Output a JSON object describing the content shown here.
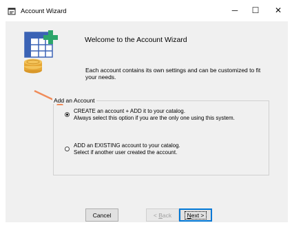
{
  "window": {
    "title": "Account Wizard",
    "controls": {
      "minimize": "─",
      "maximize": "☐",
      "close": "✕"
    }
  },
  "header": {
    "welcome_title": "Welcome to the Account Wizard",
    "intro_text": "Each account contains its own settings and can be customized to fit your needs.",
    "logo_icon": "spreadsheet-with-coins-icon"
  },
  "group": {
    "label": "Add an Account",
    "options": [
      {
        "line1": "CREATE an account + ADD it to your catalog.",
        "line2": "Always select this option if you are the only one using this system.",
        "selected": true
      },
      {
        "line1": "ADD an EXISTING account to your catalog.",
        "line2": "Select if another user created the account.",
        "selected": false
      }
    ]
  },
  "buttons": {
    "cancel": "Cancel",
    "back_prefix": "< ",
    "back_key": "B",
    "back_rest": "ack",
    "next_key": "N",
    "next_rest": "ext >"
  },
  "colors": {
    "accent": "#0078d7",
    "arrow": "#f08c5a",
    "sheet_blue": "#3b63b5",
    "plus_green": "#2ca56b",
    "coin_gold": "#e6a735"
  }
}
